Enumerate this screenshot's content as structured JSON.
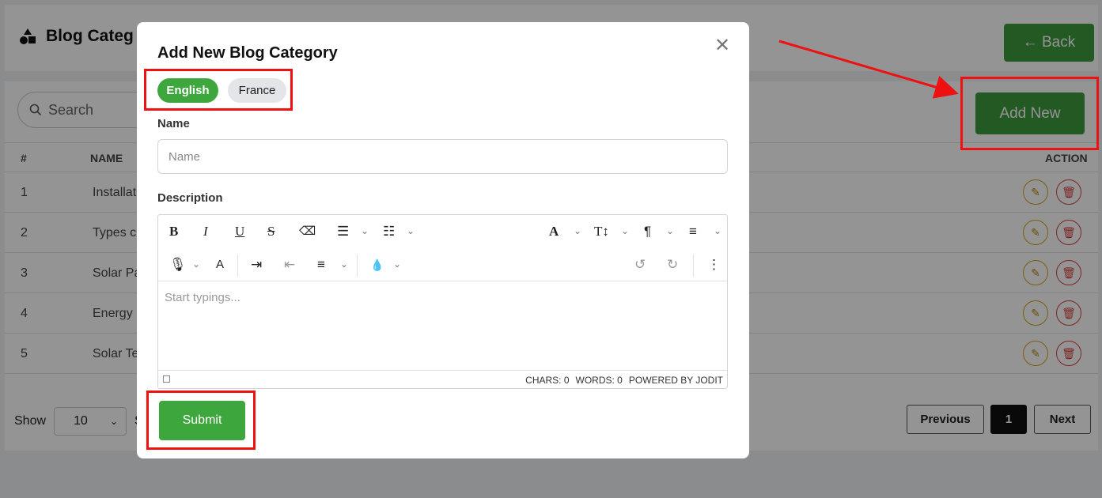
{
  "page": {
    "title": "Blog Categ",
    "back_label": "← Back",
    "search_placeholder": "Search",
    "add_new_label": "Add New",
    "table": {
      "headers": [
        "#",
        "NAME",
        "ACTION"
      ],
      "rows": [
        {
          "num": "1",
          "name": "Installat"
        },
        {
          "num": "2",
          "name": "Types c"
        },
        {
          "num": "3",
          "name": "Solar Pa"
        },
        {
          "num": "4",
          "name": "Energy"
        },
        {
          "num": "5",
          "name": "Solar Te"
        }
      ]
    },
    "footer": {
      "show_label": "Show",
      "page_size": "10",
      "trailing": "S",
      "previous_label": "Previous",
      "current_page": "1",
      "next_label": "Next"
    }
  },
  "modal": {
    "title": "Add New Blog Category",
    "close_glyph": "✕",
    "languages": [
      "English",
      "France"
    ],
    "name_label": "Name",
    "name_placeholder": "Name",
    "description_label": "Description",
    "editor_placeholder": "Start typings...",
    "editor_status": {
      "chars": "CHARS: 0",
      "words": "WORDS: 0",
      "powered": "POWERED BY JODIT"
    },
    "submit_label": "Submit"
  },
  "colors": {
    "primary_green": "#3da63d",
    "highlight_red": "#ee1111"
  }
}
